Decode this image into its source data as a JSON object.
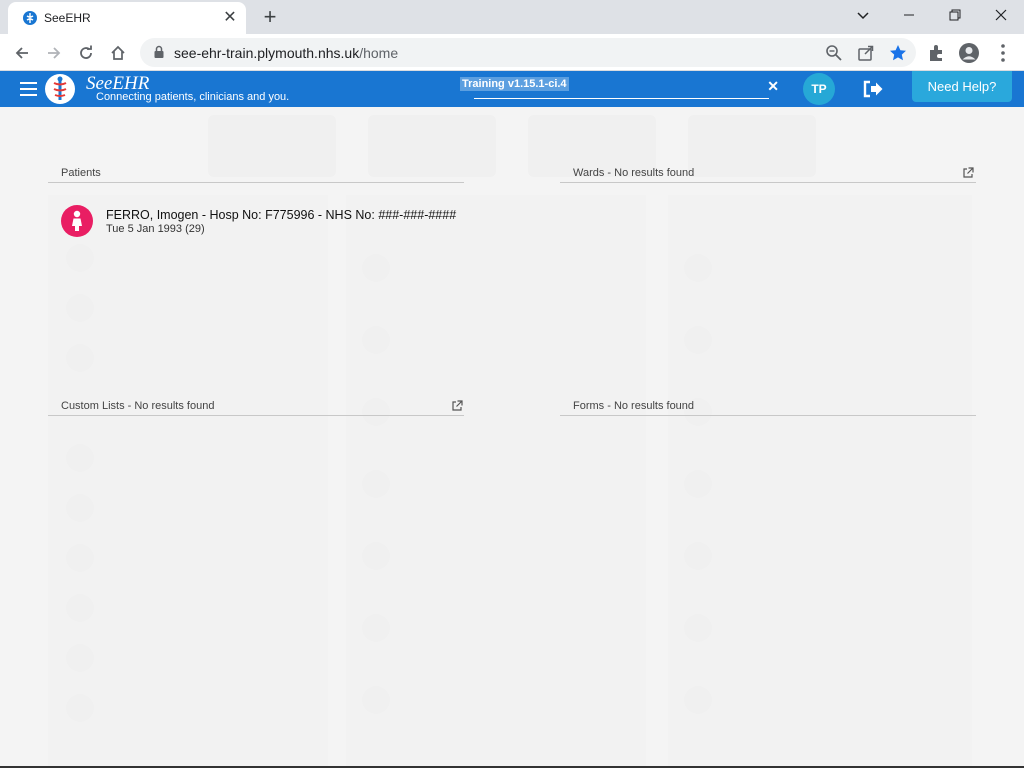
{
  "browser": {
    "tab_title": "SeeEHR",
    "url_host": "see-ehr-train.plymouth.nhs.uk",
    "url_path": "/home",
    "new_tab_symbol": "+",
    "tab_close_symbol": "✕"
  },
  "header": {
    "brand": "SeeEHR",
    "tagline": "Connecting patients, clinicians and you.",
    "environment": "Training v1.15.1-ci.4",
    "env_close_symbol": "✕",
    "user_initials": "TP",
    "help_label": "Need Help?",
    "accent_color": "#1976d2",
    "help_color": "#2aa8dc"
  },
  "results": {
    "patients": {
      "title": "Patients",
      "items": [
        {
          "name_line": "FERRO, Imogen - Hosp No: F775996 - NHS No: ###-###-####",
          "dob_line": "Tue 5 Jan 1993 (29)",
          "avatar_color": "#e91e63"
        }
      ]
    },
    "wards": {
      "title": "Wards - No results found"
    },
    "custom_lists": {
      "title": "Custom Lists - No results found"
    },
    "forms": {
      "title": "Forms - No results found"
    }
  }
}
